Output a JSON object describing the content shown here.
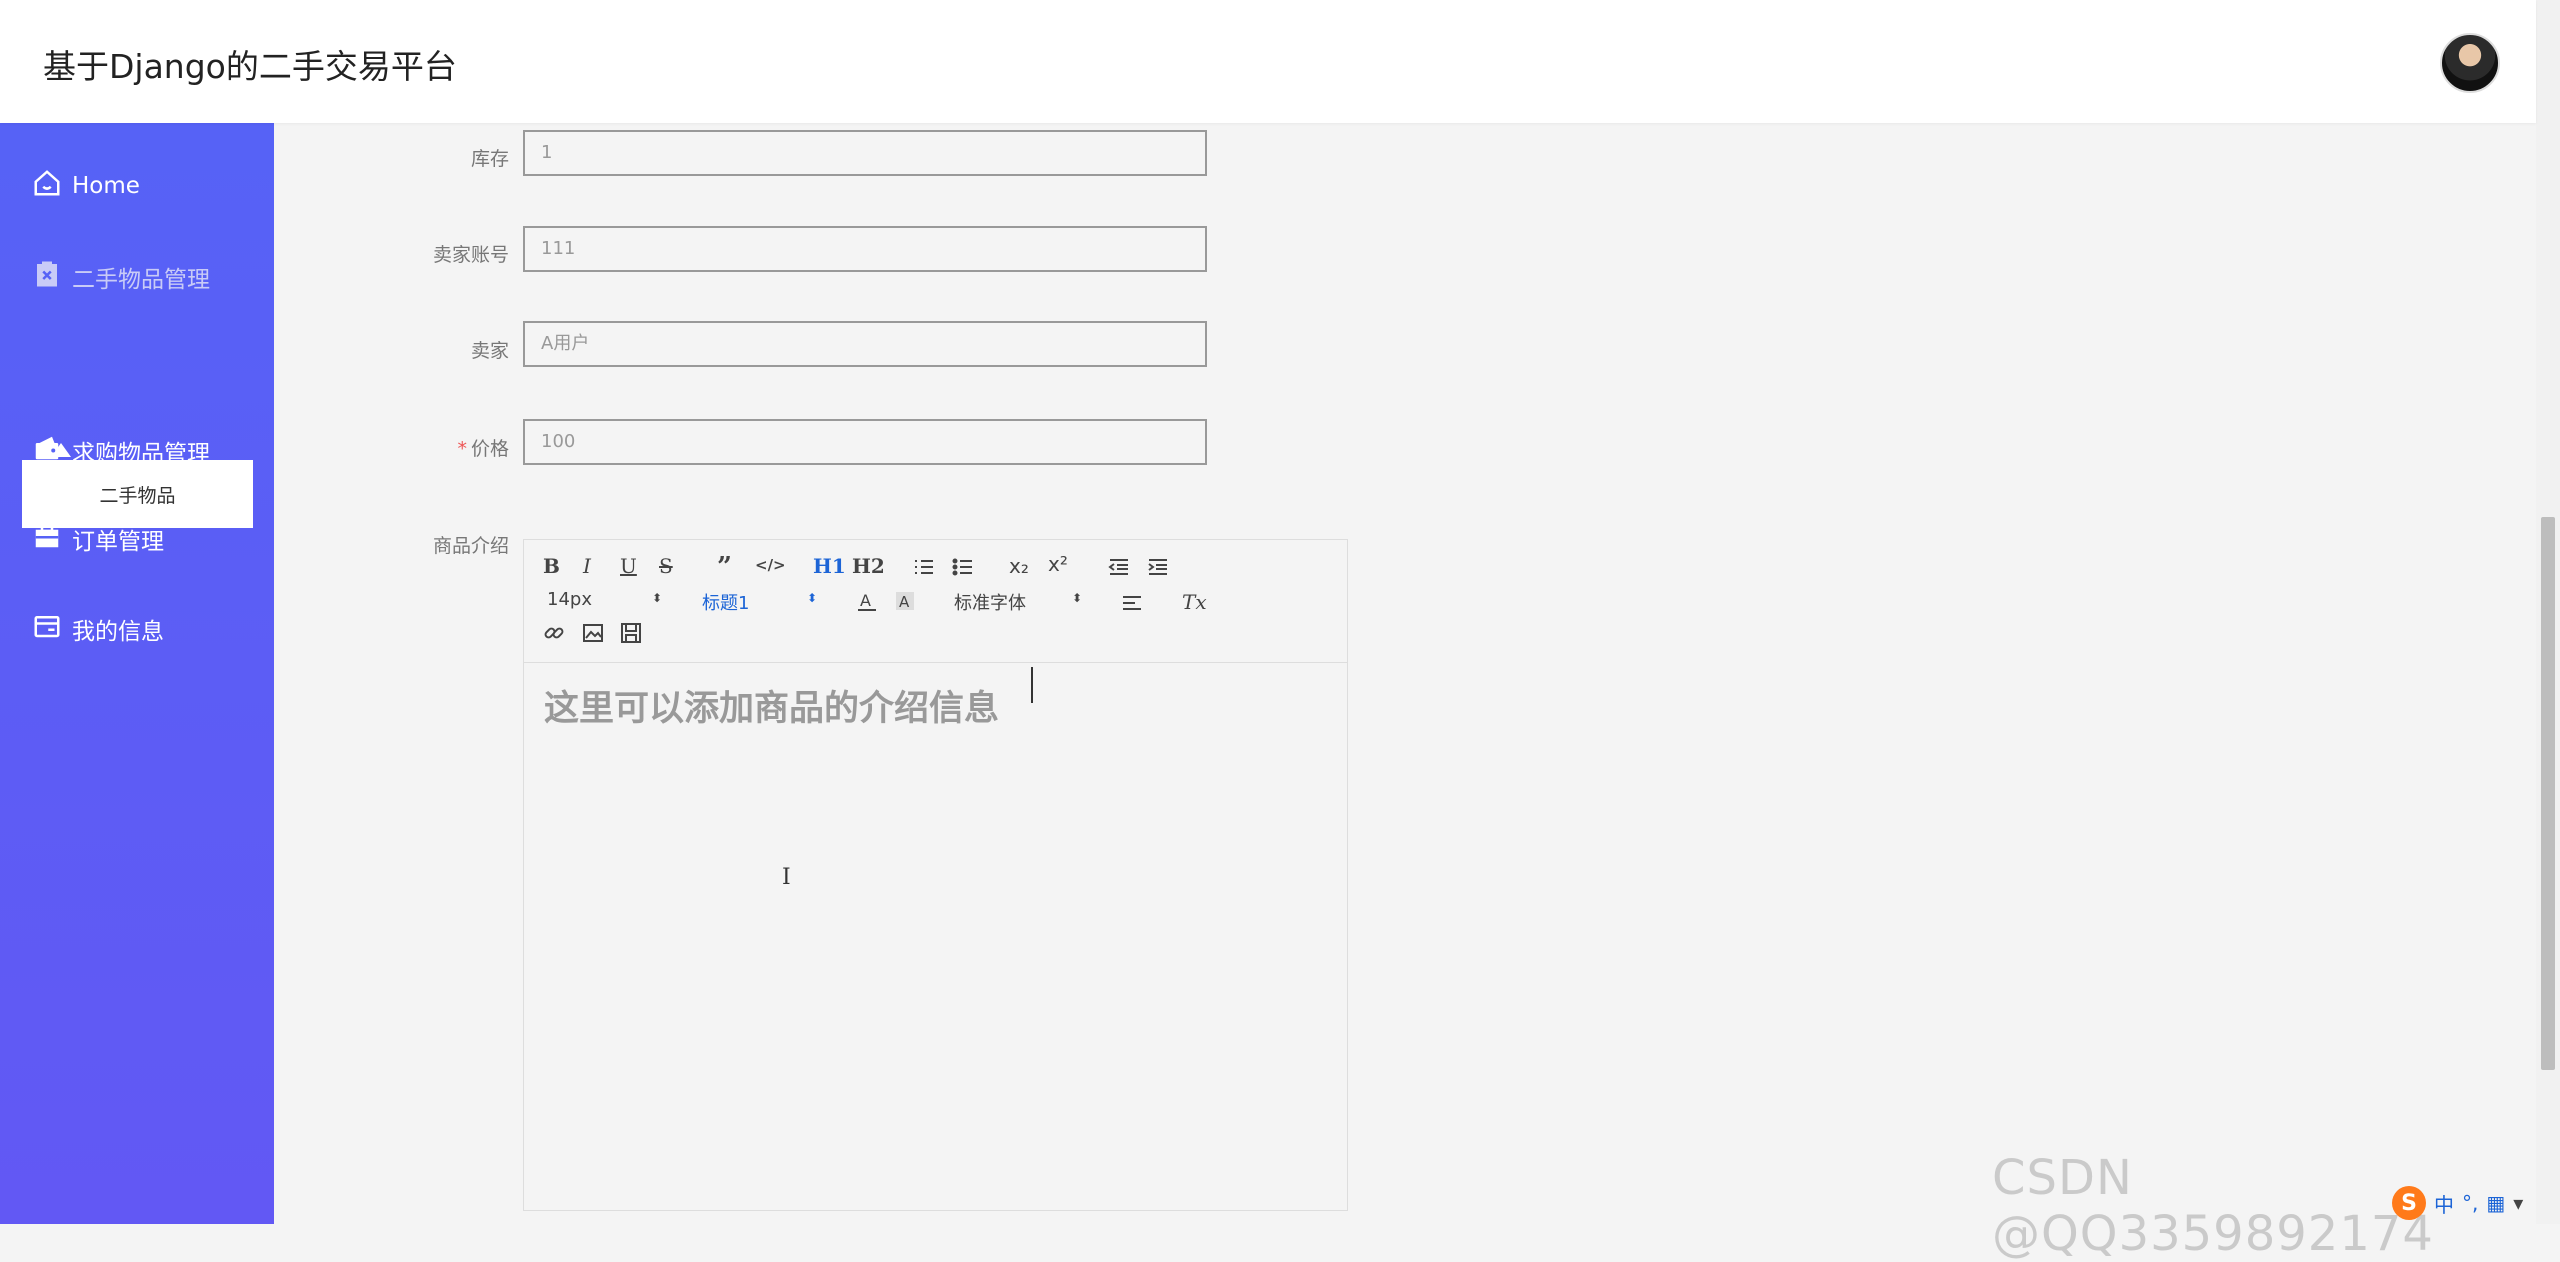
{
  "app": {
    "title": "基于Django的二手交易平台"
  },
  "sidebar": {
    "items": [
      {
        "label": "Home",
        "icon": "home-icon"
      },
      {
        "label": "二手物品管理",
        "icon": "clipboard-icon"
      },
      {
        "label": "求购物品管理",
        "icon": "wallet-icon"
      },
      {
        "label": "订单管理",
        "icon": "briefcase-icon"
      },
      {
        "label": "我的信息",
        "icon": "id-card-icon"
      }
    ],
    "submenu": {
      "label": "二手物品"
    }
  },
  "form": {
    "stock": {
      "label": "库存",
      "value": "1"
    },
    "seller_account": {
      "label": "卖家账号",
      "value": "111"
    },
    "seller": {
      "label": "卖家",
      "value": "A用户"
    },
    "price": {
      "label": "价格",
      "required_mark": "*",
      "value": "100"
    },
    "description": {
      "label": "商品介绍"
    }
  },
  "editor": {
    "toolbar": {
      "bold": "B",
      "italic": "I",
      "underline": "U",
      "strike": "S",
      "quote": "”",
      "code": "</>",
      "h1": "H1",
      "h2": "H2",
      "subscript": "x₂",
      "superscript": "x²",
      "size": "14px",
      "header": "标题1",
      "font": "标准字体",
      "clear": "Tx"
    },
    "content": "这里可以添加商品的介绍信息"
  },
  "watermark": "CSDN @QQ3359892174",
  "tray": {
    "ime": "中"
  },
  "colors": {
    "sidebar_top": "#5662f6",
    "sidebar_bottom": "#6258f4",
    "background": "#f4f4f4"
  }
}
